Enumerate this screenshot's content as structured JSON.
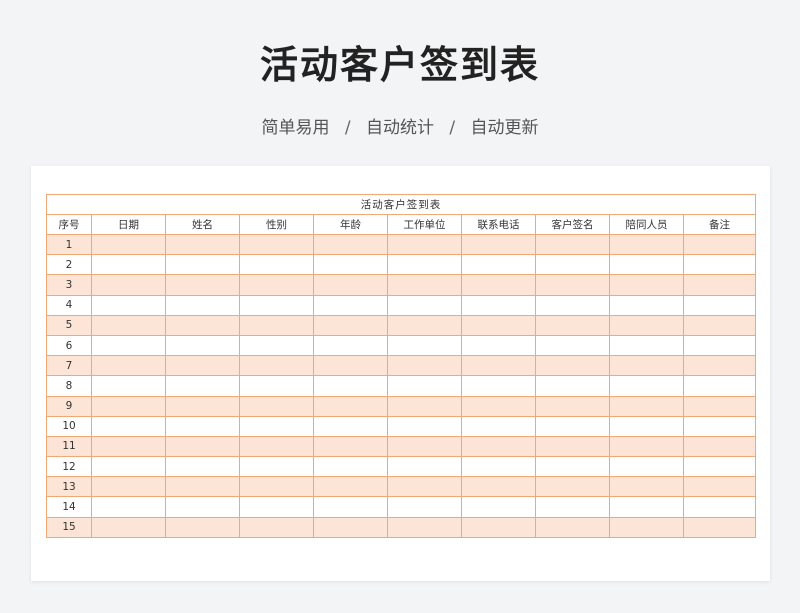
{
  "header": {
    "title": "活动客户签到表",
    "tagline": [
      "简单易用",
      "自动统计",
      "自动更新"
    ],
    "separator": "/"
  },
  "sheet": {
    "title": "活动客户签到表",
    "columns": [
      "序号",
      "日期",
      "姓名",
      "性别",
      "年龄",
      "工作单位",
      "联系电话",
      "客户签名",
      "陪同人员",
      "备注"
    ],
    "rows": [
      "1",
      "2",
      "3",
      "4",
      "5",
      "6",
      "7",
      "8",
      "9",
      "10",
      "11",
      "12",
      "13",
      "14",
      "15"
    ]
  },
  "colors": {
    "accent": "#ee7f31",
    "stripe": "#fce4d6",
    "border": "#f2a777"
  }
}
